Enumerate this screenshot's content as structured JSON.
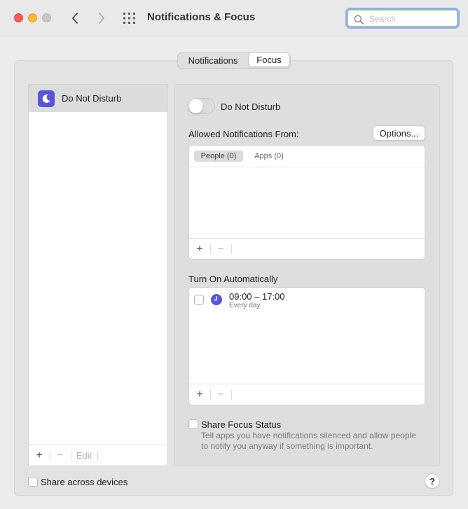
{
  "window": {
    "title": "Notifications & Focus",
    "search": {
      "placeholder": "Search",
      "value": ""
    }
  },
  "tabs": [
    {
      "label": "Notifications",
      "selected": false
    },
    {
      "label": "Focus",
      "selected": true
    }
  ],
  "focus_list": {
    "items": [
      {
        "label": "Do Not Disturb",
        "icon": "moon-icon",
        "selected": true
      }
    ],
    "footer": {
      "add": "+",
      "remove": "−",
      "edit": "Edit"
    }
  },
  "detail": {
    "toggle_label": "Do Not Disturb",
    "toggle_on": false,
    "allowed_label": "Allowed Notifications From:",
    "options_button": "Options...",
    "allowed_tabs": [
      {
        "label": "People (0)",
        "selected": true
      },
      {
        "label": "Apps (0)",
        "selected": false
      }
    ],
    "allowed_footer": {
      "add": "+",
      "remove": "−"
    },
    "auto_label": "Turn On Automatically",
    "schedule": {
      "time": "09:00 – 17:00",
      "days": "Every day",
      "enabled": false,
      "icon": "clock-icon"
    },
    "auto_footer": {
      "add": "+",
      "remove": "−"
    },
    "share_status_label": "Share Focus Status",
    "share_status_desc": "Tell apps you have notifications silenced and allow people to notify you anyway if something is important."
  },
  "share_devices_label": "Share across devices",
  "help_label": "?",
  "colors": {
    "accent": "#5856d6",
    "close": "#ee5f58",
    "minimize": "#f5bd2f",
    "maximize": "#c7c7c7",
    "search_focus_ring": "#8fb1e8"
  }
}
